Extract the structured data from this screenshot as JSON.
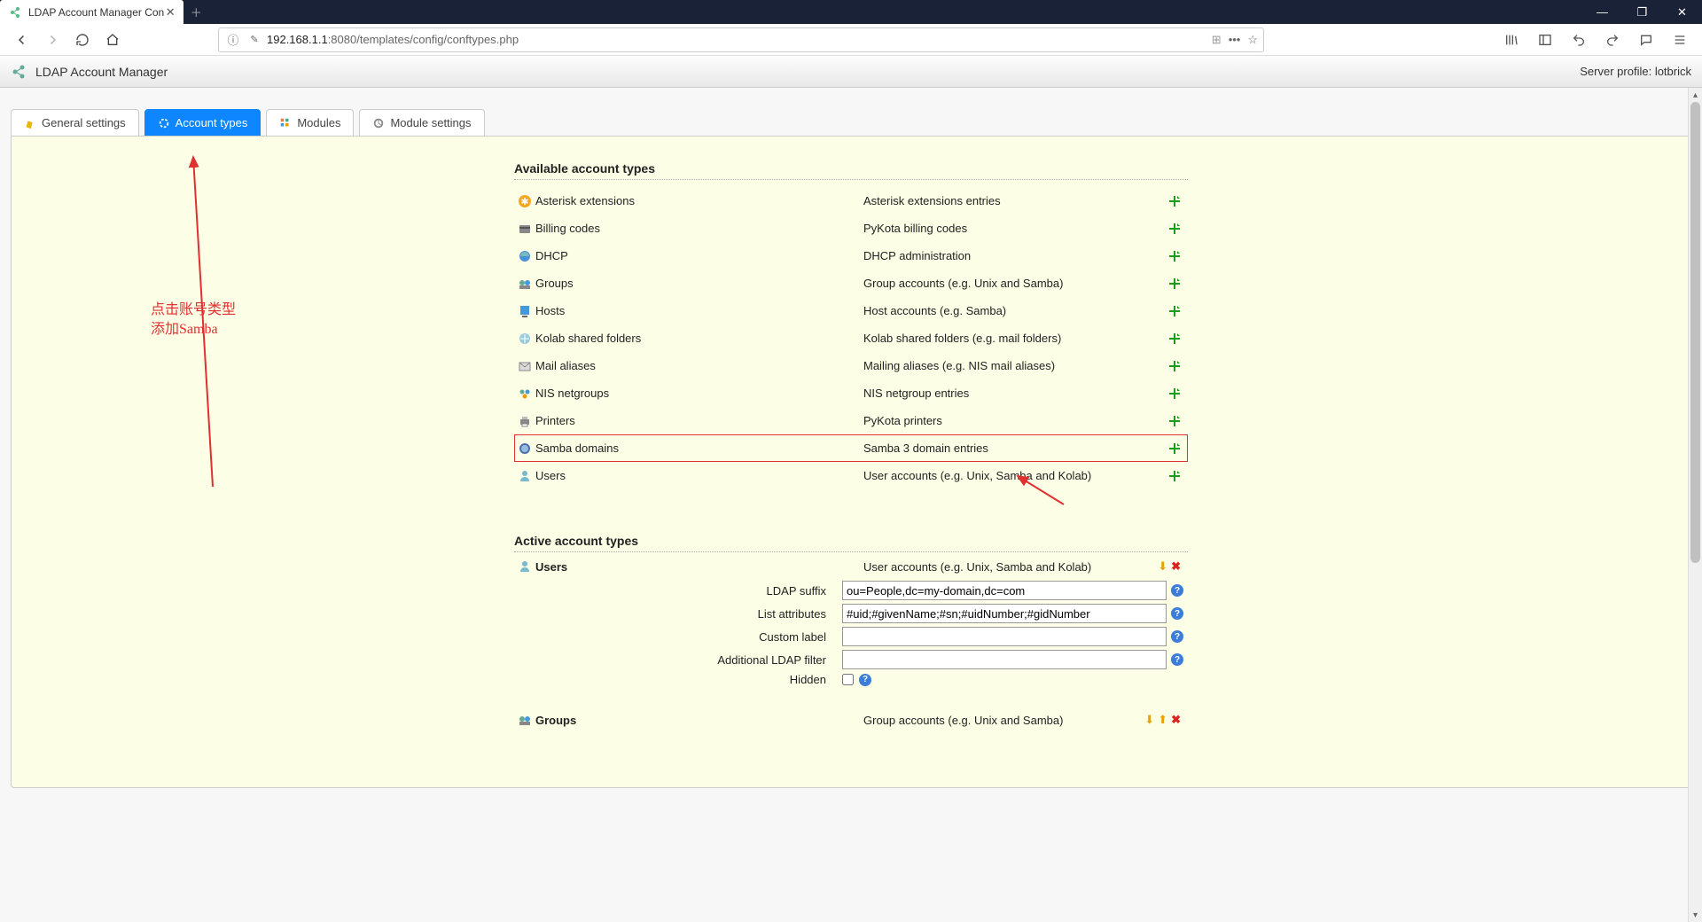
{
  "browser": {
    "tab_title": "LDAP Account Manager Con",
    "url_pre": "192.168.1.1",
    "url_post": ":8080/templates/config/conftypes.php"
  },
  "header": {
    "title": "LDAP Account Manager",
    "profile_label": "Server profile: ",
    "profile_name": "lotbrick"
  },
  "tabs": [
    {
      "label": "General settings",
      "active": false
    },
    {
      "label": "Account types",
      "active": true
    },
    {
      "label": "Modules",
      "active": false
    },
    {
      "label": "Module settings",
      "active": false
    }
  ],
  "sections": {
    "available_title": "Available account types",
    "active_title": "Active account types"
  },
  "available": [
    {
      "icon": "asterisk",
      "name": "Asterisk extensions",
      "desc": "Asterisk extensions entries",
      "hl": false
    },
    {
      "icon": "billing",
      "name": "Billing codes",
      "desc": "PyKota billing codes",
      "hl": false
    },
    {
      "icon": "dhcp",
      "name": "DHCP",
      "desc": "DHCP administration",
      "hl": false
    },
    {
      "icon": "groups",
      "name": "Groups",
      "desc": "Group accounts (e.g. Unix and Samba)",
      "hl": false
    },
    {
      "icon": "hosts",
      "name": "Hosts",
      "desc": "Host accounts (e.g. Samba)",
      "hl": false
    },
    {
      "icon": "kolab",
      "name": "Kolab shared folders",
      "desc": "Kolab shared folders (e.g. mail folders)",
      "hl": false
    },
    {
      "icon": "mail",
      "name": "Mail aliases",
      "desc": "Mailing aliases (e.g. NIS mail aliases)",
      "hl": false
    },
    {
      "icon": "nis",
      "name": "NIS netgroups",
      "desc": "NIS netgroup entries",
      "hl": false
    },
    {
      "icon": "printers",
      "name": "Printers",
      "desc": "PyKota printers",
      "hl": false
    },
    {
      "icon": "samba",
      "name": "Samba domains",
      "desc": "Samba 3 domain entries",
      "hl": true
    },
    {
      "icon": "users",
      "name": "Users",
      "desc": "User accounts (e.g. Unix, Samba and Kolab)",
      "hl": false
    }
  ],
  "active": [
    {
      "icon": "users",
      "name": "Users",
      "desc": "User accounts (e.g. Unix, Samba and Kolab)",
      "fields": {
        "ldap_suffix_label": "LDAP suffix",
        "ldap_suffix_value": "ou=People,dc=my-domain,dc=com",
        "list_attr_label": "List attributes",
        "list_attr_value": "#uid;#givenName;#sn;#uidNumber;#gidNumber",
        "custom_label_label": "Custom label",
        "custom_label_value": "",
        "add_filter_label": "Additional LDAP filter",
        "add_filter_value": "",
        "hidden_label": "Hidden"
      }
    },
    {
      "icon": "groups",
      "name": "Groups",
      "desc": "Group accounts (e.g. Unix and Samba)"
    }
  ],
  "annotation": {
    "line1": "点击账号类型",
    "line2": "添加Samba"
  }
}
